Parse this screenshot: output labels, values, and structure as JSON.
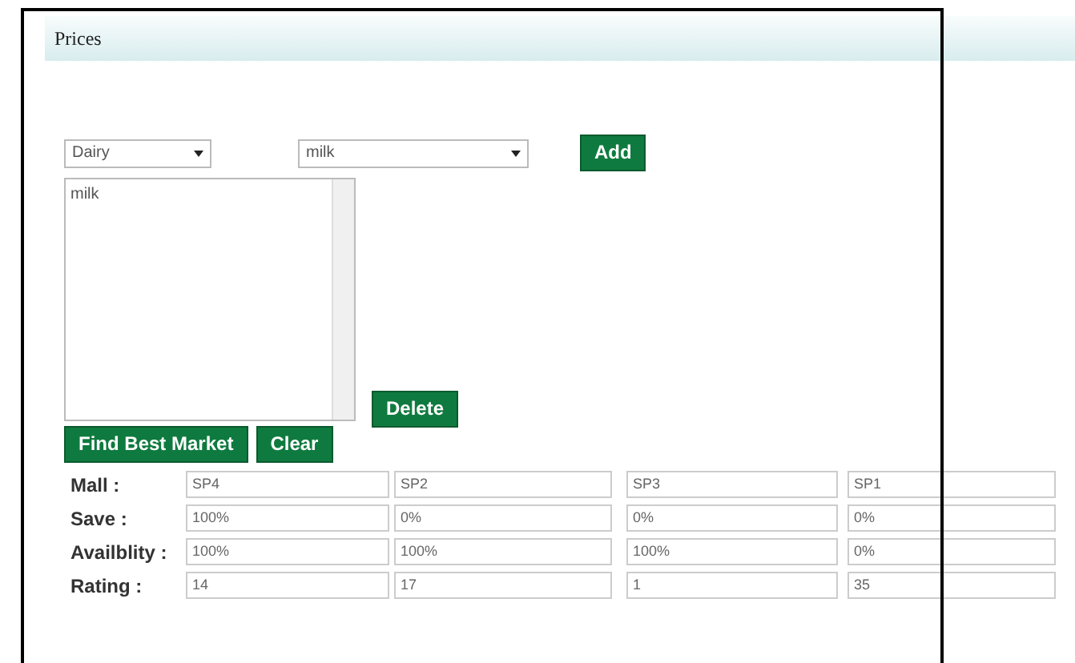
{
  "header": {
    "title": "Prices"
  },
  "category_select": {
    "value": "Dairy"
  },
  "product_select": {
    "value": "milk"
  },
  "add_button": "Add",
  "selected_list": {
    "items": [
      "milk"
    ]
  },
  "delete_button": "Delete",
  "find_button": "Find Best Market",
  "clear_button": "Clear",
  "results": [
    {
      "label": "Mall :",
      "values": [
        "SP4",
        "SP2",
        "SP3",
        "SP1"
      ]
    },
    {
      "label": "Save :",
      "values": [
        "100%",
        "0%",
        "0%",
        "0%"
      ]
    },
    {
      "label": "Availblity :",
      "values": [
        "100%",
        "100%",
        "100%",
        "0%"
      ]
    },
    {
      "label": "Rating :",
      "values": [
        "14",
        "17",
        "1",
        "35"
      ]
    }
  ]
}
